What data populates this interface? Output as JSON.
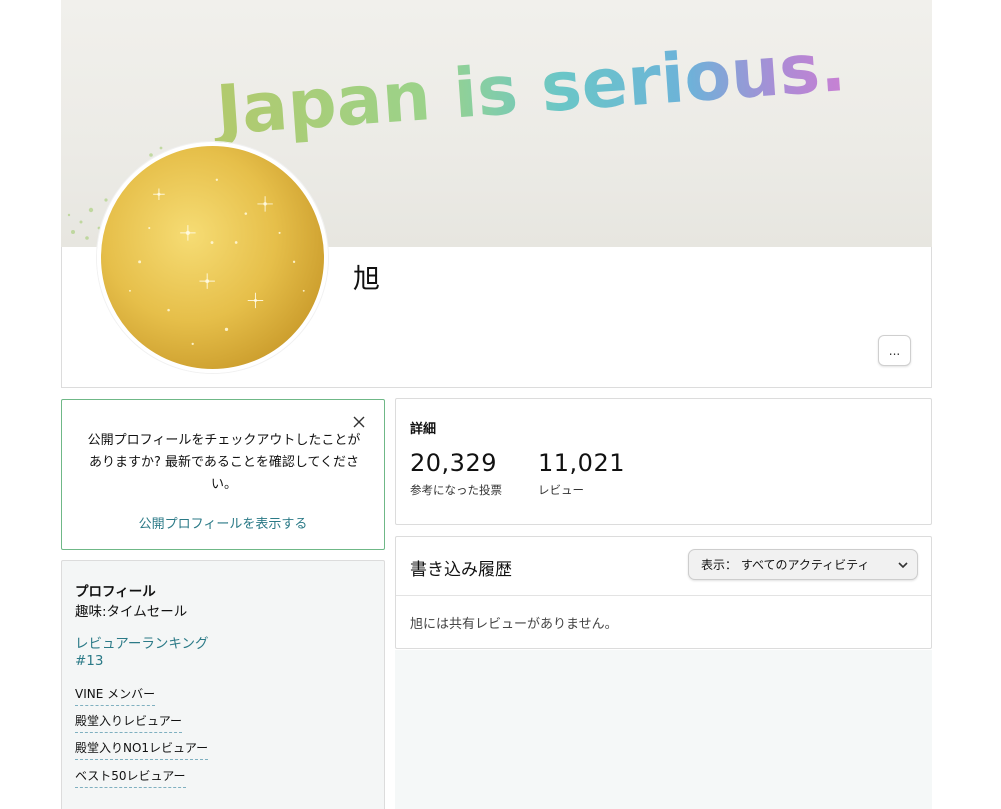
{
  "banner": {
    "tagline": "Japan is serious."
  },
  "profile_header": {
    "user_name": "旭",
    "more_button_label": "..."
  },
  "notice": {
    "message": "公開プロフィールをチェックアウトしたことがありますか? 最新であることを確認してください。",
    "link_label": "公開プロフィールを表示する"
  },
  "profile": {
    "title": "プロフィール",
    "hobby": "趣味:タイムセール",
    "ranking_label": "レビュアーランキング",
    "ranking_value": "#13",
    "badges": [
      "VINE メンバー",
      "殿堂入りレビュアー",
      "殿堂入りNO1レビュアー",
      "ベスト50レビュアー"
    ]
  },
  "stats": {
    "title": "詳細",
    "items": [
      {
        "value": "20,329",
        "label": "参考になった投票"
      },
      {
        "value": "11,021",
        "label": "レビュー"
      }
    ]
  },
  "activity": {
    "title": "書き込み履歴",
    "filter_label": "表示： すべてのアクティビティ",
    "empty_message": "旭には共有レビューがありません。"
  },
  "colors": {
    "link": "#2b7a87",
    "notice_border": "#6fb887",
    "avatar_gold": "#e6bf4a"
  }
}
